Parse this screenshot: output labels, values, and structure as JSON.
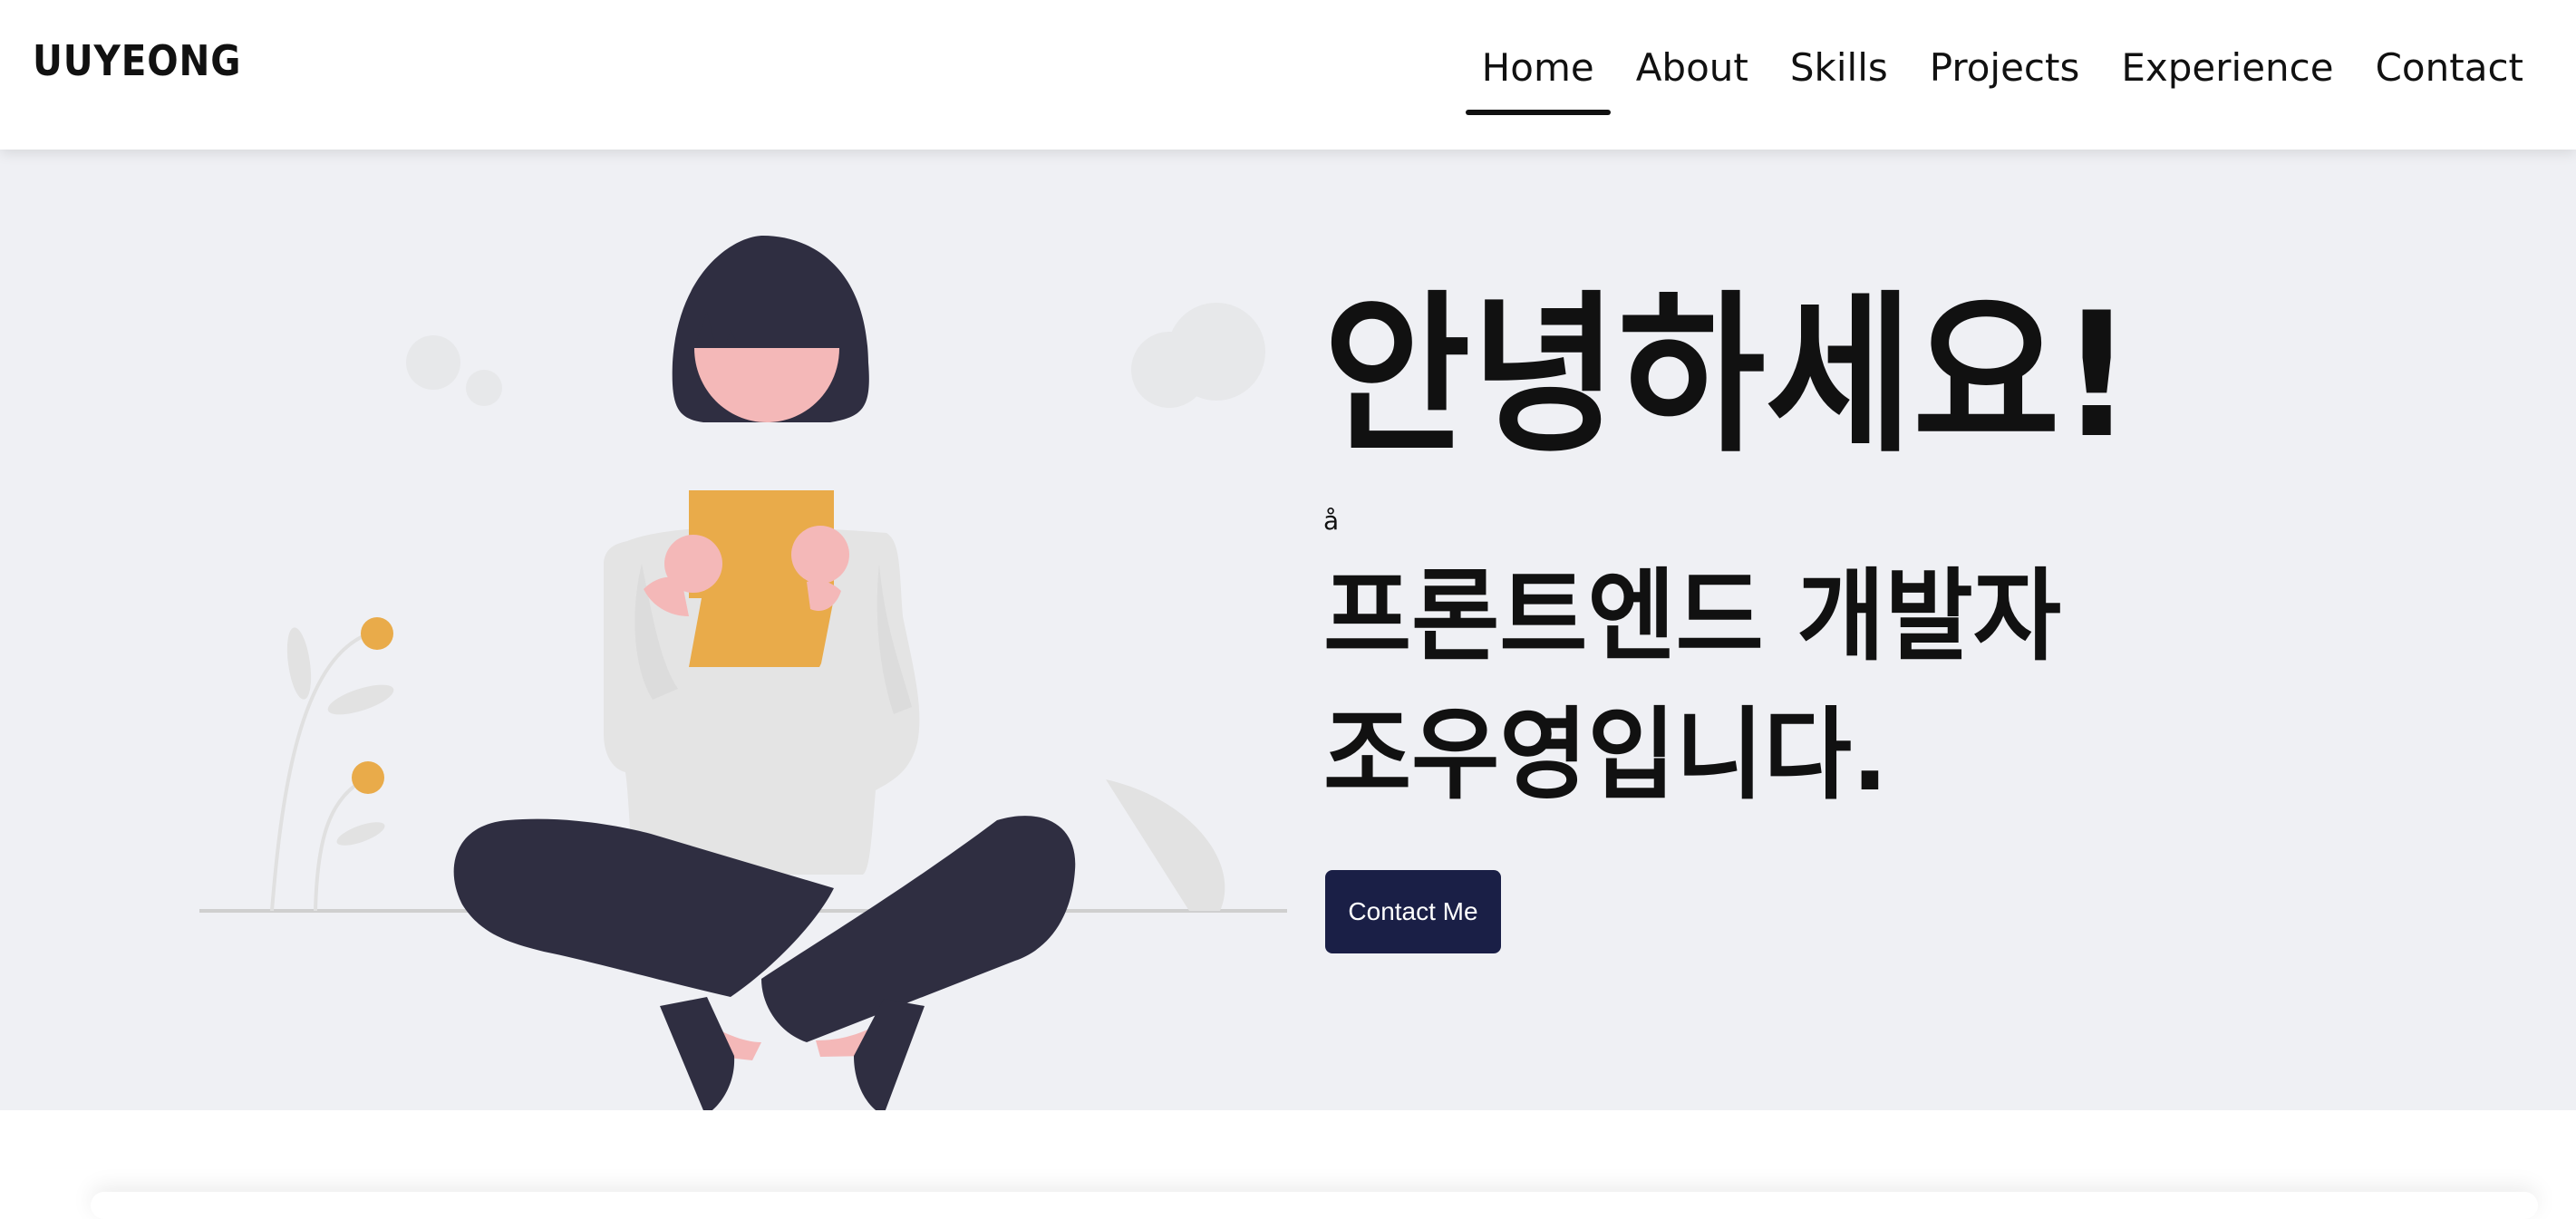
{
  "header": {
    "brand": "UUYEONG",
    "nav": [
      "Home",
      "About",
      "Skills",
      "Projects",
      "Experience",
      "Contact"
    ],
    "active": "Home"
  },
  "hero": {
    "greeting": "안녕하세요!",
    "glyph": "å",
    "intro_line_1": "프론트엔드 개발자",
    "intro_line_2": "조우영입니다.",
    "cta_label": "Contact Me"
  },
  "colors": {
    "hero_background": "#eff0f4",
    "button_background": "#1a1f46",
    "accent_yellow": "#e9ab4a",
    "skin": "#f4b8b8",
    "dark": "#2f2e41",
    "shirt": "#e4e4e4"
  }
}
